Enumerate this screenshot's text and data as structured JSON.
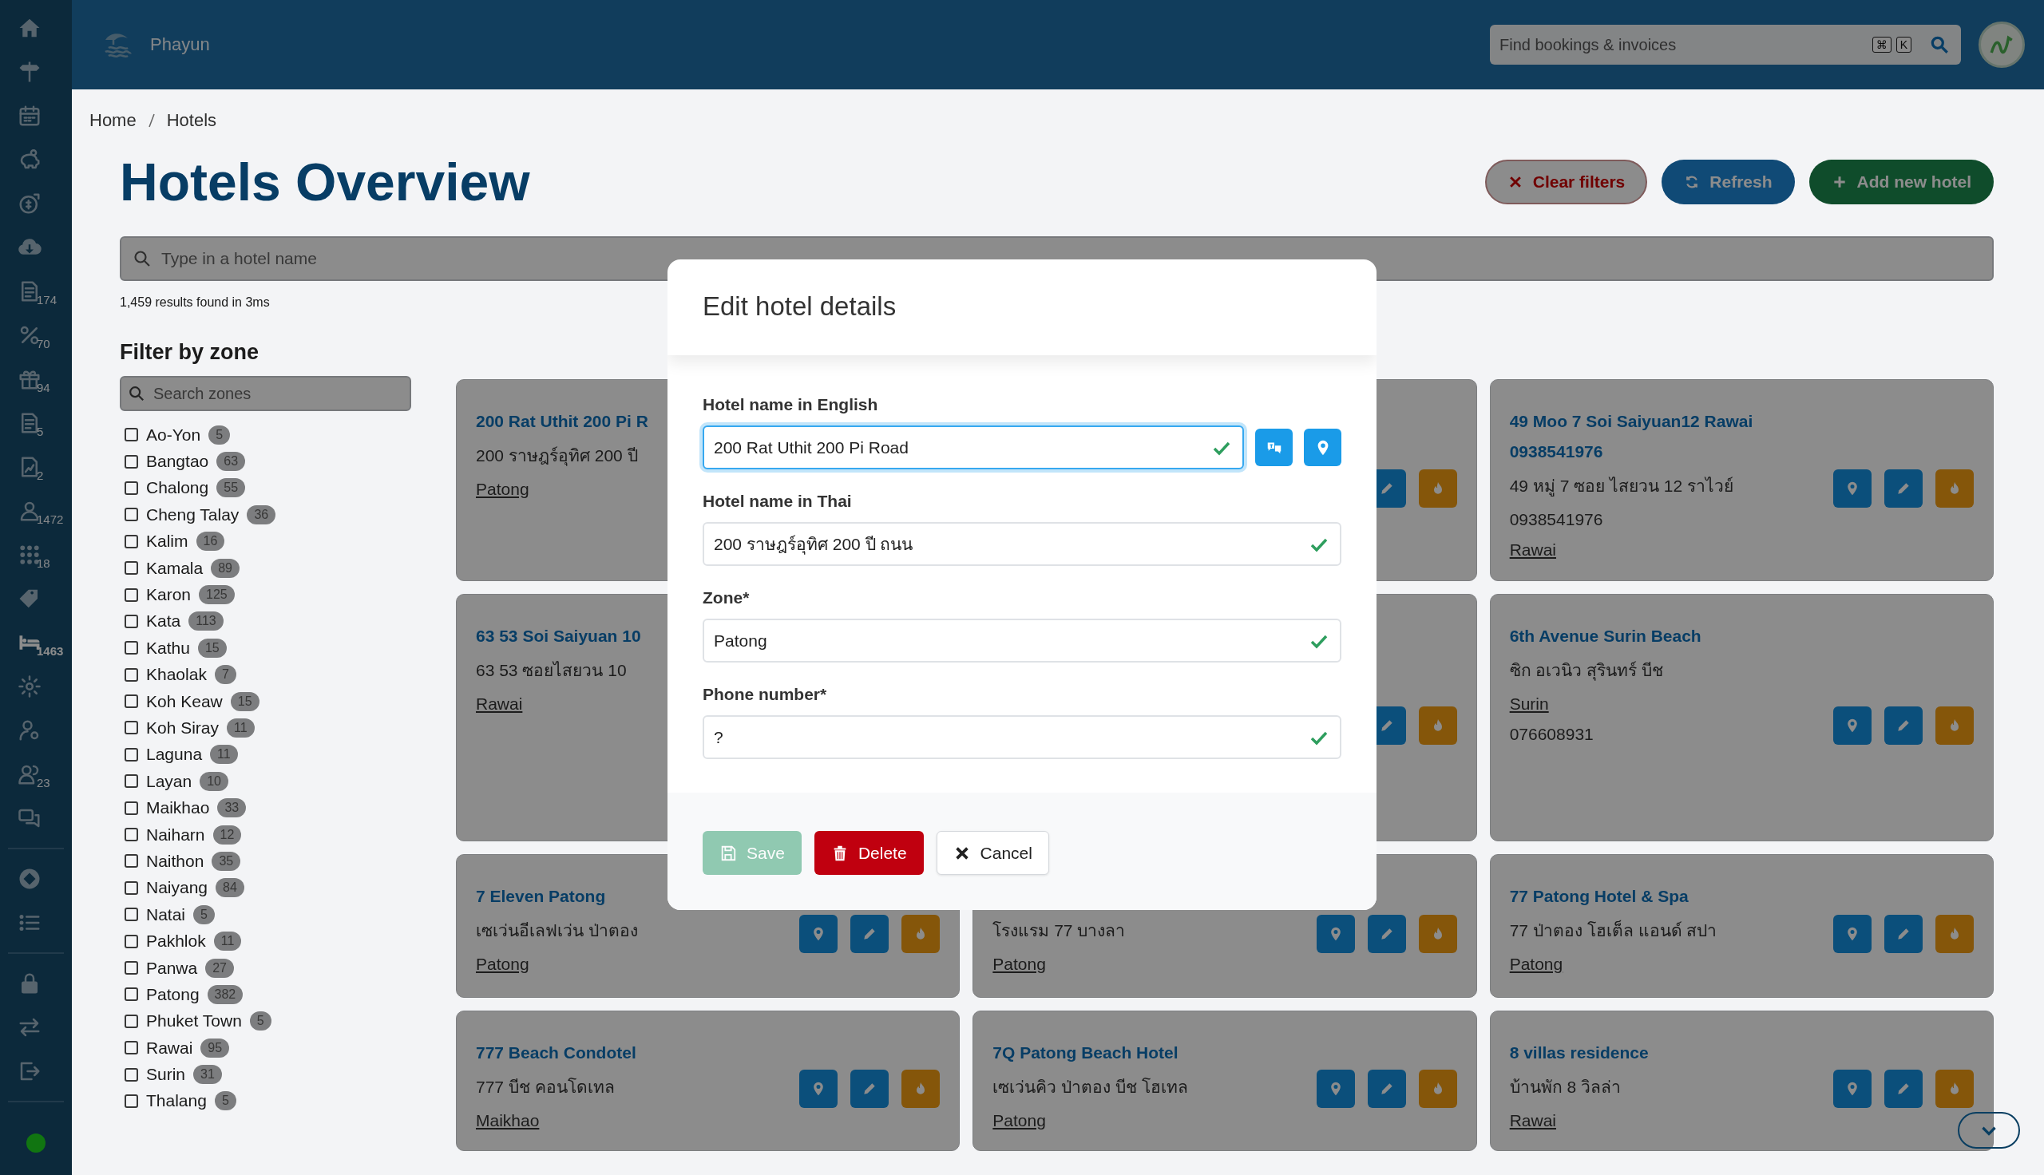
{
  "sidebar": {
    "sections": [
      {
        "items": [
          {
            "selected": false
          },
          {
            "selected": false
          },
          {
            "selected": false
          },
          {
            "selected": false
          },
          {
            "selected": false
          },
          {
            "selected": false
          },
          {
            "selected": false,
            "badge": "174"
          },
          {
            "selected": false,
            "badge": "70"
          },
          {
            "selected": false,
            "badge": "94"
          },
          {
            "selected": false,
            "badge": "5"
          },
          {
            "selected": false,
            "badge": "2"
          },
          {
            "selected": false,
            "badge": "1472"
          },
          {
            "selected": false,
            "badge": "18"
          },
          {
            "selected": false
          },
          {
            "selected": true,
            "badge": "1463"
          },
          {
            "selected": false
          },
          {
            "selected": false
          },
          {
            "selected": false,
            "badge": "23"
          },
          {
            "selected": false
          }
        ]
      },
      {
        "items": [
          {
            "selected": false
          },
          {
            "selected": false
          }
        ]
      },
      {
        "items": [
          {
            "selected": false
          },
          {
            "selected": false
          },
          {
            "selected": false
          }
        ]
      }
    ],
    "online": true
  },
  "topbar": {
    "brand": "Phayun",
    "search": {
      "placeholder": "Find bookings & invoices",
      "shortcut": [
        "⌘",
        "K"
      ]
    }
  },
  "breadcrumb": [
    "Home",
    "Hotels"
  ],
  "page": {
    "title": "Hotels Overview",
    "actions": [
      {
        "kind": "clear",
        "label": "Clear filters"
      },
      {
        "kind": "refresh",
        "label": "Refresh"
      },
      {
        "kind": "add",
        "label": "Add new hotel"
      }
    ],
    "search": {
      "placeholder": "Type in a hotel name"
    },
    "results": "1,459 results found in 3ms"
  },
  "filter": {
    "title": "Filter by zone",
    "search": {
      "placeholder": "Search zones"
    },
    "zones": [
      {
        "name": "Ao-Yon",
        "count": "5",
        "checked": false
      },
      {
        "name": "Bangtao",
        "count": "63",
        "checked": false
      },
      {
        "name": "Chalong",
        "count": "55",
        "checked": false
      },
      {
        "name": "Cheng Talay",
        "count": "36",
        "checked": false
      },
      {
        "name": "Kalim",
        "count": "16",
        "checked": false
      },
      {
        "name": "Kamala",
        "count": "89",
        "checked": false
      },
      {
        "name": "Karon",
        "count": "125",
        "checked": false
      },
      {
        "name": "Kata",
        "count": "113",
        "checked": false
      },
      {
        "name": "Kathu",
        "count": "15",
        "checked": false
      },
      {
        "name": "Khaolak",
        "count": "7",
        "checked": false
      },
      {
        "name": "Koh Keaw",
        "count": "15",
        "checked": false
      },
      {
        "name": "Koh Siray",
        "count": "11",
        "checked": false
      },
      {
        "name": "Laguna",
        "count": "11",
        "checked": false
      },
      {
        "name": "Layan",
        "count": "10",
        "checked": false
      },
      {
        "name": "Maikhao",
        "count": "33",
        "checked": false
      },
      {
        "name": "Naiharn",
        "count": "12",
        "checked": false
      },
      {
        "name": "Naithon",
        "count": "35",
        "checked": false
      },
      {
        "name": "Naiyang",
        "count": "84",
        "checked": false
      },
      {
        "name": "Natai",
        "count": "5",
        "checked": false
      },
      {
        "name": "Pakhlok",
        "count": "11",
        "checked": false
      },
      {
        "name": "Panwa",
        "count": "27",
        "checked": false
      },
      {
        "name": "Patong",
        "count": "382",
        "checked": false
      },
      {
        "name": "Phuket Town",
        "count": "5",
        "checked": false
      },
      {
        "name": "Rawai",
        "count": "95",
        "checked": false
      },
      {
        "name": "Surin",
        "count": "31",
        "checked": false
      },
      {
        "name": "Thalang",
        "count": "5",
        "checked": false
      }
    ]
  },
  "hotel_columns": [
    {
      "hotels": [
        {
          "title": "200 Rat Uthit 200 Pi R",
          "lines": [
            {
              "kind": "text",
              "text": "200 ราษฎร์อุทิศ 200 ปี"
            },
            {
              "kind": "link",
              "text": "Patong"
            }
          ]
        },
        {
          "title": "63 53 Soi Saiyuan 10",
          "lines": [
            {
              "kind": "text",
              "text": "63 53 ซอยไสยวน 10"
            },
            {
              "kind": "link",
              "text": "Rawai"
            }
          ]
        },
        {
          "title": "7 Eleven Patong",
          "lines": [
            {
              "kind": "text",
              "text": "เซเว่นอีเลฟเว่น ป่าตอง"
            },
            {
              "kind": "link",
              "text": "Patong"
            }
          ]
        },
        {
          "title": "777 Beach Condotel",
          "lines": [
            {
              "kind": "text",
              "text": "777 บีช คอนโดเทล"
            },
            {
              "kind": "link",
              "text": "Maikhao"
            }
          ]
        }
      ]
    },
    {
      "hotels": [
        {
          "lines": [
            {
              "kind": "text",
              "text": "โรงแรม 77 บางลา"
            },
            {
              "kind": "link",
              "text": "Patong"
            }
          ]
        },
        {
          "title": "7Q Patong Beach Hotel",
          "lines": [
            {
              "kind": "text",
              "text": "เซเว่นคิว ป่าตอง บีช โฮเทล"
            },
            {
              "kind": "link",
              "text": "Patong"
            }
          ]
        }
      ]
    },
    {
      "hotels": [
        {
          "title": "49 Moo 7 Soi Saiyuan12 Rawai",
          "lines": [
            {
              "kind": "phone",
              "text": "0938541976"
            },
            {
              "kind": "text",
              "text": "49 หมู่ 7 ซอย ไสยวน 12 ราไวย์"
            },
            {
              "kind": "text",
              "text": "0938541976"
            },
            {
              "kind": "link",
              "text": "Rawai"
            }
          ]
        },
        {
          "title": "6th Avenue Surin Beach",
          "lines": [
            {
              "kind": "text",
              "text": "ซิก อเวนิว สุรินทร์ บีช"
            },
            {
              "kind": "link",
              "text": "Surin"
            },
            {
              "kind": "text",
              "text": "076608931"
            }
          ]
        },
        {
          "title": "77 Patong Hotel & Spa",
          "lines": [
            {
              "kind": "text",
              "text": "77 ป่าตอง โฮเต็ล แอนด์ สปา"
            },
            {
              "kind": "link",
              "text": "Patong"
            }
          ]
        },
        {
          "title": "8 villas residence",
          "lines": [
            {
              "kind": "text",
              "text": "บ้านพัก 8 วิลล่า"
            },
            {
              "kind": "link",
              "text": "Rawai"
            }
          ]
        }
      ]
    }
  ],
  "modal": {
    "title": "Edit hotel details",
    "fields": [
      {
        "kind": "with-tools",
        "label": "Hotel name in English",
        "value": "200 Rat Uthit 200 Pi Road",
        "valid": true,
        "focused": true
      },
      {
        "kind": "plain",
        "label": "Hotel name in Thai",
        "value": "200 ราษฎร์อุทิศ 200 ปี ถนน",
        "valid": true,
        "focused": false
      },
      {
        "kind": "plain",
        "label": "Zone*",
        "value": "Patong",
        "valid": true,
        "focused": false
      },
      {
        "kind": "plain",
        "label": "Phone number*",
        "value": "?",
        "valid": true,
        "focused": false
      }
    ],
    "buttons": [
      {
        "kind": "save",
        "label": "Save",
        "disabled": true
      },
      {
        "kind": "delete",
        "label": "Delete",
        "disabled": false
      },
      {
        "kind": "cancel",
        "label": "Cancel",
        "disabled": false
      }
    ]
  }
}
